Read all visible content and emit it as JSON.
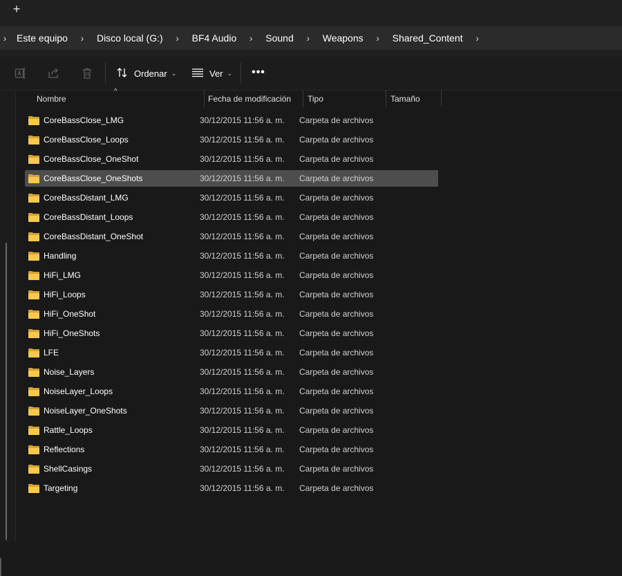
{
  "tabbar": {
    "new_tab_glyph": "+"
  },
  "breadcrumb": {
    "leading_chevron": "›",
    "separator": "›",
    "items": [
      "Este equipo",
      "Disco local (G:)",
      "BF4 Audio",
      "Sound",
      "Weapons",
      "Shared_Content"
    ]
  },
  "toolbar": {
    "rename_icon": "rename-icon",
    "share_icon": "share-icon",
    "delete_icon": "trash-icon",
    "sort_label": "Ordenar",
    "view_label": "Ver",
    "more_label": "•••",
    "dropdown_caret": "⌄"
  },
  "columns": {
    "name": "Nombre",
    "modified": "Fecha de modificación",
    "type": "Tipo",
    "size": "Tamaño",
    "sort_indicator": "^"
  },
  "files": [
    {
      "name": "CoreBassClose_LMG",
      "modified": "30/12/2015 11:56 a. m.",
      "type": "Carpeta de archivos",
      "selected": false
    },
    {
      "name": "CoreBassClose_Loops",
      "modified": "30/12/2015 11:56 a. m.",
      "type": "Carpeta de archivos",
      "selected": false
    },
    {
      "name": "CoreBassClose_OneShot",
      "modified": "30/12/2015 11:56 a. m.",
      "type": "Carpeta de archivos",
      "selected": false
    },
    {
      "name": "CoreBassClose_OneShots",
      "modified": "30/12/2015 11:56 a. m.",
      "type": "Carpeta de archivos",
      "selected": true
    },
    {
      "name": "CoreBassDistant_LMG",
      "modified": "30/12/2015 11:56 a. m.",
      "type": "Carpeta de archivos",
      "selected": false
    },
    {
      "name": "CoreBassDistant_Loops",
      "modified": "30/12/2015 11:56 a. m.",
      "type": "Carpeta de archivos",
      "selected": false
    },
    {
      "name": "CoreBassDistant_OneShot",
      "modified": "30/12/2015 11:56 a. m.",
      "type": "Carpeta de archivos",
      "selected": false
    },
    {
      "name": "Handling",
      "modified": "30/12/2015 11:56 a. m.",
      "type": "Carpeta de archivos",
      "selected": false
    },
    {
      "name": "HiFi_LMG",
      "modified": "30/12/2015 11:56 a. m.",
      "type": "Carpeta de archivos",
      "selected": false
    },
    {
      "name": "HiFi_Loops",
      "modified": "30/12/2015 11:56 a. m.",
      "type": "Carpeta de archivos",
      "selected": false
    },
    {
      "name": "HiFi_OneShot",
      "modified": "30/12/2015 11:56 a. m.",
      "type": "Carpeta de archivos",
      "selected": false
    },
    {
      "name": "HiFi_OneShots",
      "modified": "30/12/2015 11:56 a. m.",
      "type": "Carpeta de archivos",
      "selected": false
    },
    {
      "name": "LFE",
      "modified": "30/12/2015 11:56 a. m.",
      "type": "Carpeta de archivos",
      "selected": false
    },
    {
      "name": "Noise_Layers",
      "modified": "30/12/2015 11:56 a. m.",
      "type": "Carpeta de archivos",
      "selected": false
    },
    {
      "name": "NoiseLayer_Loops",
      "modified": "30/12/2015 11:56 a. m.",
      "type": "Carpeta de archivos",
      "selected": false
    },
    {
      "name": "NoiseLayer_OneShots",
      "modified": "30/12/2015 11:56 a. m.",
      "type": "Carpeta de archivos",
      "selected": false
    },
    {
      "name": "Rattle_Loops",
      "modified": "30/12/2015 11:56 a. m.",
      "type": "Carpeta de archivos",
      "selected": false
    },
    {
      "name": "Reflections",
      "modified": "30/12/2015 11:56 a. m.",
      "type": "Carpeta de archivos",
      "selected": false
    },
    {
      "name": "ShellCasings",
      "modified": "30/12/2015 11:56 a. m.",
      "type": "Carpeta de archivos",
      "selected": false
    },
    {
      "name": "Targeting",
      "modified": "30/12/2015 11:56 a. m.",
      "type": "Carpeta de archivos",
      "selected": false
    }
  ],
  "colors": {
    "background": "#191919",
    "chrome": "#202020",
    "address_bg": "#2b2b2b",
    "selection": "#4d4d4d",
    "folder_front": "#f6c94e",
    "folder_back": "#d6a234"
  }
}
